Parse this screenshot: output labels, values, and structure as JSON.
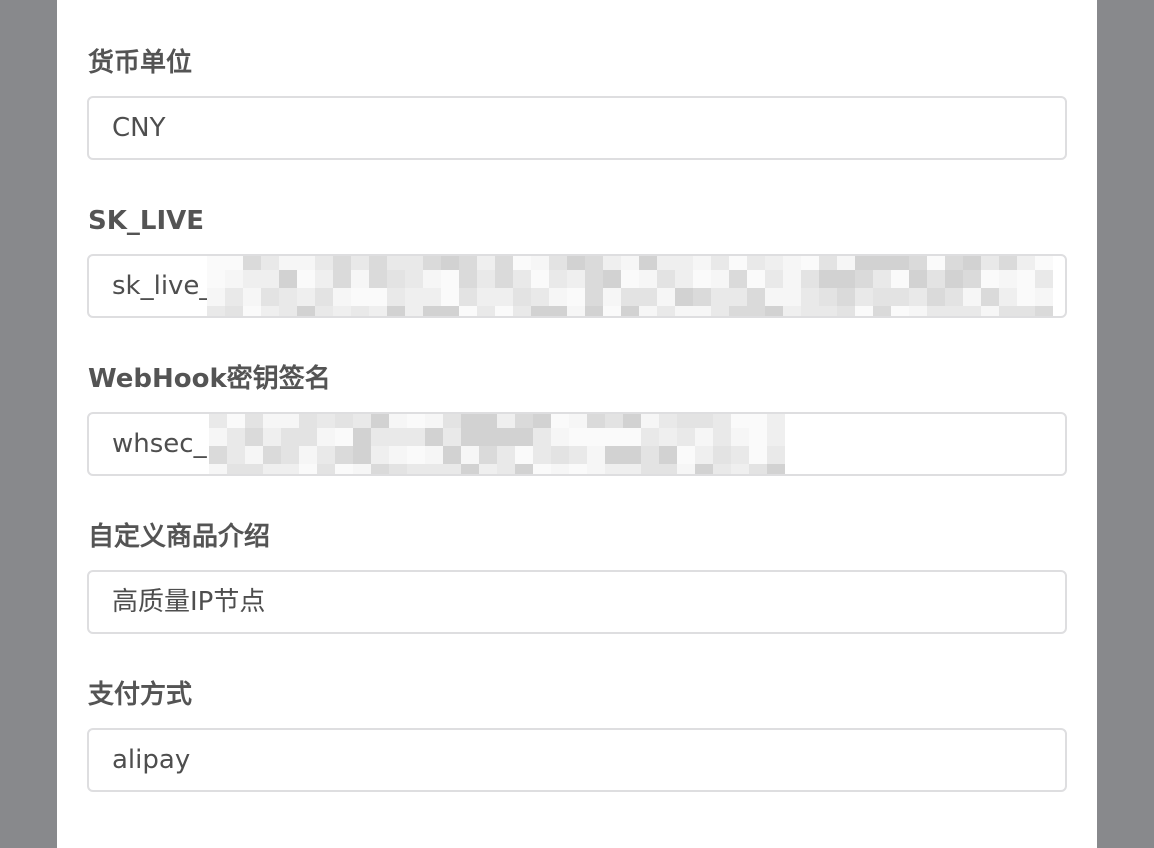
{
  "form": {
    "fields": [
      {
        "label": "货币单位",
        "value": "CNY"
      },
      {
        "label": "SK_LIVE",
        "value": "sk_live_"
      },
      {
        "label": "WebHook密钥签名",
        "value": "whsec_"
      },
      {
        "label": "自定义商品介绍",
        "value": "高质量IP节点"
      },
      {
        "label": "支付方式",
        "value": "alipay"
      }
    ]
  },
  "colors": {
    "overlay": "#88898c",
    "modal_background": "#ffffff",
    "label_text": "#545454",
    "input_text": "#4e4e4e",
    "input_border": "#dedee0",
    "redaction_light": "#ececec",
    "redaction_dark": "#cfcfcf"
  },
  "redactions": [
    {
      "field": "SK_LIVE",
      "style": "pixelated-blur"
    },
    {
      "field": "WebHook密钥签名",
      "style": "pixelated-blur"
    }
  ]
}
